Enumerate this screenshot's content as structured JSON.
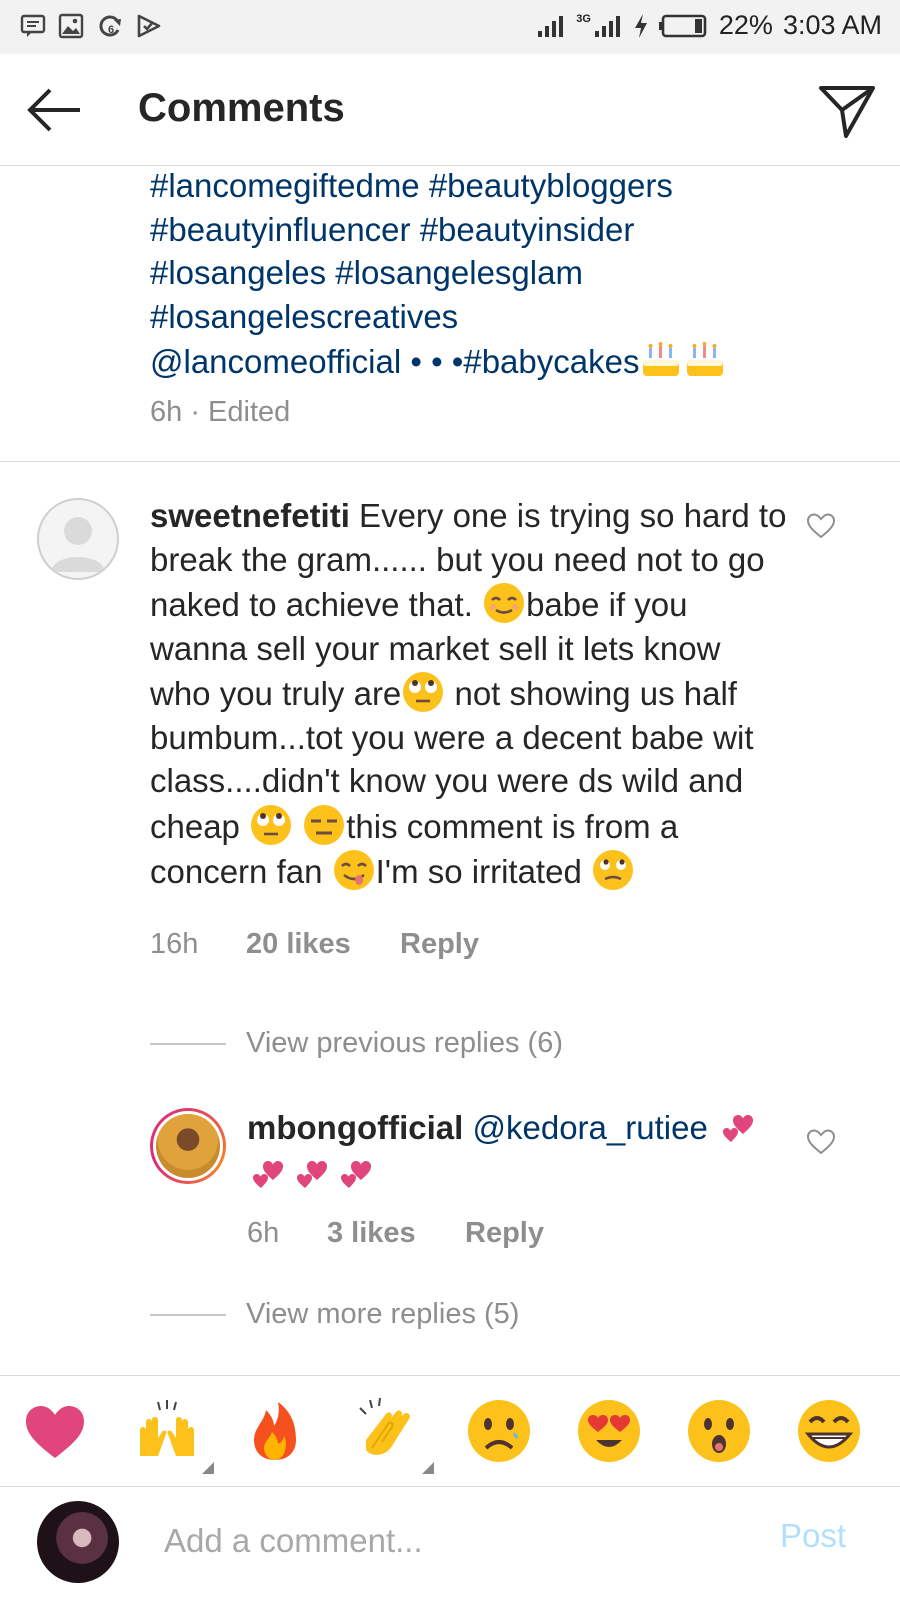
{
  "statusbar": {
    "icons": [
      "message-icon",
      "gallery-icon",
      "sync-icon",
      "check-icon"
    ],
    "network": "3G",
    "battery": "22%",
    "time": "3:03 AM"
  },
  "header": {
    "title": "Comments"
  },
  "caption": {
    "lines": [
      "#lancomegiftedme #beautybloggers",
      "#beautyinfluencer #beautyinsider",
      "#losangeles #losangelesglam",
      "#losangelescreatives"
    ],
    "last_line": "@lancomeofficial • • •#babycakes",
    "meta": "6h · Edited"
  },
  "comment": {
    "username": "sweetnefetiti",
    "segments": [
      " Every one is trying so hard to break the gram...... but you need not to go naked to achieve that. ",
      "babe if you wanna sell your market sell it lets know who you truly are",
      " not showing us half bumbum...tot you were a decent babe wit class....didn't know you were ds wild and cheap ",
      " ",
      "this comment is from a concern fan ",
      "I'm so irritated "
    ],
    "time": "16h",
    "likes": "20 likes",
    "reply": "Reply",
    "view_previous": "View previous replies (6)"
  },
  "reply": {
    "username": "mbongofficial",
    "mention": "@kedora_rutiee",
    "time": "6h",
    "likes": "3 likes",
    "reply": "Reply",
    "view_more": "View more replies (5)"
  },
  "emoji_bar": [
    "heart",
    "raised-hands",
    "fire",
    "clapping-hands",
    "sad-face",
    "heart-eyes",
    "surprised-face",
    "grinning-face"
  ],
  "input": {
    "placeholder": "Add a comment...",
    "post": "Post"
  },
  "colors": {
    "hashtag": "#003569",
    "meta": "#8e8e8e",
    "post_disabled": "#b2dffc",
    "emoji_yellow": "#fcc21b"
  }
}
